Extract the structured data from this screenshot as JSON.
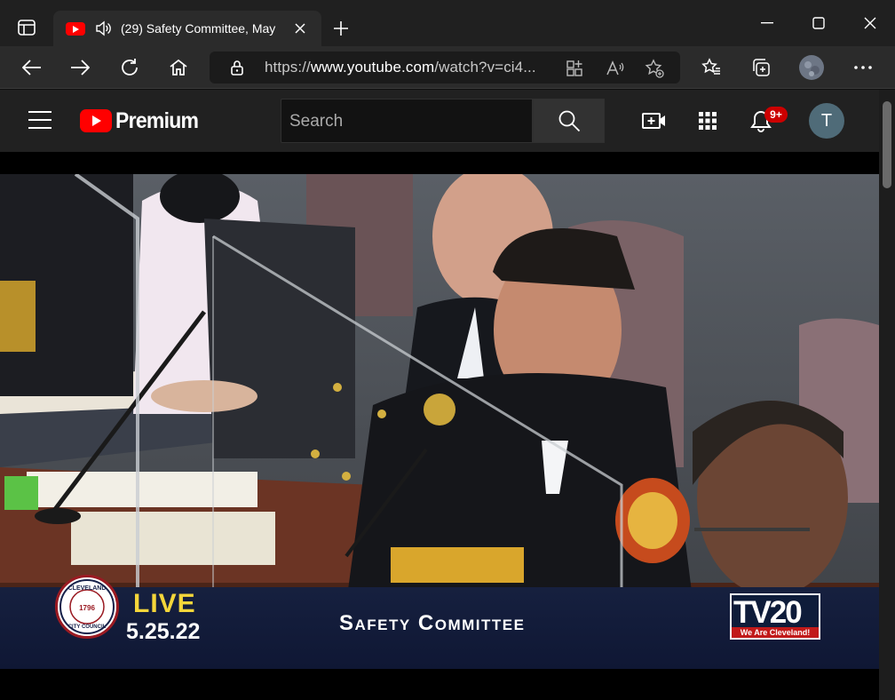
{
  "browser": {
    "tab": {
      "title": "(29) Safety Committee, May",
      "close_icon": "close-icon",
      "audio_icon": "speaker-icon"
    },
    "new_tab_label": "+",
    "address": {
      "url_prefix": "https://",
      "url_host": "www.youtube.com",
      "url_path": "/watch?v=ci4..."
    }
  },
  "youtube": {
    "brand": "Premium",
    "search_placeholder": "Search",
    "notifications_badge": "9+",
    "avatar_letter": "T"
  },
  "video": {
    "overlay": {
      "live_label": "LIVE",
      "date": "5.25.22",
      "show_title": "Safety Committee",
      "seal_top": "CLEVELAND",
      "seal_year": "1796",
      "seal_bottom": "CITY COUNCIL",
      "station_logo": "TV20",
      "station_tagline": "We Are Cleveland!"
    }
  },
  "colors": {
    "youtube_red": "#ff0000",
    "live_yellow": "#f4d63a",
    "badge_red": "#cc0000",
    "lower_third_blue": "#16203f"
  }
}
